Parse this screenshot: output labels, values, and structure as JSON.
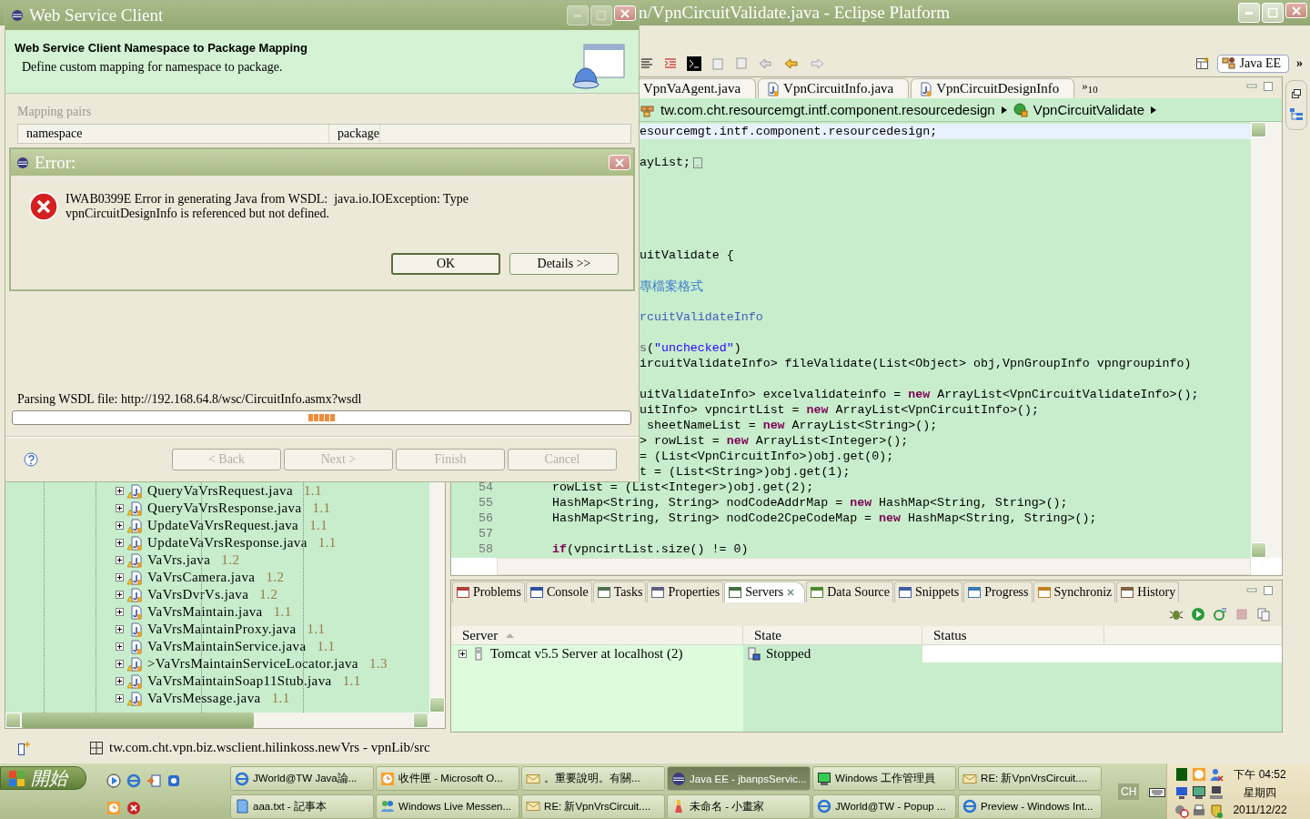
{
  "eclipse": {
    "title": "n/VpnCircuitValidate.java - Eclipse Platform",
    "perspective": "Java EE",
    "toolbar_overflow": "»",
    "editor": {
      "tabs": [
        {
          "label": "VpnVaAgent.java",
          "selected": false
        },
        {
          "label": "VpnCircuitInfo.java",
          "selected": false
        },
        {
          "label": "VpnCircuitDesignInfo",
          "selected": false
        }
      ],
      "more_tabs": "»$_{10}$",
      "breadcrumb": [
        {
          "kind": "package",
          "label": "tw.com.cht.resourcemgt.intf.component.resourcedesign"
        },
        {
          "kind": "class",
          "label": "VpnCircuitValidate"
        }
      ],
      "code_lines": [
        {
          "kind": "code",
          "clipped": true,
          "current": true,
          "parts": [
            {
              "kind": "plain",
              "text": "esourcemgt.intf.component.resourcedesign;"
            }
          ]
        },
        {
          "kind": "blank"
        },
        {
          "kind": "code",
          "clipped": true,
          "folded": true,
          "parts": [
            {
              "kind": "plain",
              "text": "ayList;"
            }
          ]
        },
        {
          "kind": "blank"
        },
        {
          "kind": "blank"
        },
        {
          "kind": "blank"
        },
        {
          "kind": "blank"
        },
        {
          "kind": "blank"
        },
        {
          "kind": "code",
          "clipped": true,
          "parts": [
            {
              "kind": "plain",
              "text": "uitValidate {"
            }
          ]
        },
        {
          "kind": "blank"
        },
        {
          "kind": "code",
          "clipped": true,
          "parts": [
            {
              "kind": "comment",
              "text": "專檔案格式"
            }
          ]
        },
        {
          "kind": "blank"
        },
        {
          "kind": "code",
          "clipped": true,
          "parts": [
            {
              "kind": "javadoc",
              "text": "rcuitValidateInfo"
            }
          ]
        },
        {
          "kind": "blank"
        },
        {
          "kind": "code",
          "clipped": true,
          "parts": [
            {
              "kind": "annotation",
              "text": "s"
            },
            {
              "kind": "plain",
              "text": "("
            },
            {
              "kind": "string",
              "text": "\"unchecked\""
            },
            {
              "kind": "plain",
              "text": ")"
            }
          ]
        },
        {
          "kind": "code",
          "clipped": true,
          "parts": [
            {
              "kind": "plain",
              "text": "ircuitValidateInfo> fileValidate(List<Object> obj,VpnGroupInfo vpngroupinfo)"
            }
          ]
        },
        {
          "kind": "blank"
        },
        {
          "kind": "code",
          "clipped": true,
          "parts": [
            {
              "kind": "plain",
              "text": "uitValidateInfo> excelvalidateinfo = "
            },
            {
              "kind": "keyword",
              "text": "new"
            },
            {
              "kind": "plain",
              "text": " ArrayList<VpnCircuitValidateInfo>();"
            }
          ]
        },
        {
          "kind": "code",
          "clipped": true,
          "parts": [
            {
              "kind": "plain",
              "text": "uitInfo> vpncirtList = "
            },
            {
              "kind": "keyword",
              "text": "new"
            },
            {
              "kind": "plain",
              "text": " ArrayList<VpnCircuitInfo>();"
            }
          ]
        },
        {
          "kind": "code",
          "clipped": true,
          "parts": [
            {
              "kind": "plain",
              "text": " sheetNameList = "
            },
            {
              "kind": "keyword",
              "text": "new"
            },
            {
              "kind": "plain",
              "text": " ArrayList<String>();"
            }
          ]
        },
        {
          "kind": "code",
          "clipped": true,
          "parts": [
            {
              "kind": "plain",
              "text": "> rowList = "
            },
            {
              "kind": "keyword",
              "text": "new"
            },
            {
              "kind": "plain",
              "text": " ArrayList<Integer>();"
            }
          ]
        },
        {
          "kind": "code",
          "clipped": true,
          "parts": [
            {
              "kind": "plain",
              "text": "= (List<VpnCircuitInfo>)obj.get(0);"
            }
          ]
        },
        {
          "kind": "code",
          "clipped": true,
          "parts": [
            {
              "kind": "plain",
              "text": "t = (List<String>)obj.get(1);"
            }
          ]
        },
        {
          "kind": "code",
          "number": "54",
          "clipped": false,
          "parts": [
            {
              "kind": "plain",
              "text": "rowList = (List<Integer>)obj.get(2);"
            }
          ]
        },
        {
          "kind": "code",
          "number": "55",
          "clipped": false,
          "parts": [
            {
              "kind": "plain",
              "text": "HashMap<String, String> nodCodeAddrMap = "
            },
            {
              "kind": "keyword",
              "text": "new"
            },
            {
              "kind": "plain",
              "text": " HashMap<String, String>();"
            }
          ]
        },
        {
          "kind": "code",
          "number": "56",
          "clipped": false,
          "parts": [
            {
              "kind": "plain",
              "text": "HashMap<String, String> nodCode2CpeCodeMap = "
            },
            {
              "kind": "keyword",
              "text": "new"
            },
            {
              "kind": "plain",
              "text": " HashMap<String, String>();"
            }
          ]
        },
        {
          "kind": "blank",
          "number": "57"
        },
        {
          "kind": "code",
          "number": "58",
          "clipped": false,
          "parts": [
            {
              "kind": "keyword",
              "text": "if"
            },
            {
              "kind": "plain",
              "text": "(vpncirtList.size() != 0)"
            }
          ]
        }
      ]
    },
    "explorer": {
      "items": [
        {
          "name": "QueryVaVrsRequest.java",
          "version": "1.1",
          "warning": true,
          "expanded": false
        },
        {
          "name": "QueryVaVrsResponse.java",
          "version": "1.1",
          "warning": true,
          "expanded": false
        },
        {
          "name": "UpdateVaVrsRequest.java",
          "version": "1.1",
          "warning": true,
          "expanded": false
        },
        {
          "name": "UpdateVaVrsResponse.java",
          "version": "1.1",
          "warning": true,
          "expanded": false
        },
        {
          "name": "VaVrs.java",
          "version": "1.2",
          "warning": true,
          "expanded": false
        },
        {
          "name": "VaVrsCamera.java",
          "version": "1.2",
          "warning": true,
          "expanded": false
        },
        {
          "name": "VaVrsDvrVs.java",
          "version": "1.2",
          "warning": true,
          "expanded": false
        },
        {
          "name": "VaVrsMaintain.java",
          "version": "1.1",
          "warning": false,
          "expanded": false
        },
        {
          "name": "VaVrsMaintainProxy.java",
          "version": "1.1",
          "warning": false,
          "expanded": false
        },
        {
          "name": "VaVrsMaintainService.java",
          "version": "1.1",
          "warning": false,
          "expanded": false
        },
        {
          "name": ">VaVrsMaintainServiceLocator.java",
          "version": "1.3",
          "warning": true,
          "expanded": false
        },
        {
          "name": "VaVrsMaintainSoap11Stub.java",
          "version": "1.1",
          "warning": true,
          "expanded": false
        },
        {
          "name": "VaVrsMessage.java",
          "version": "1.1",
          "warning": true,
          "expanded": false
        }
      ]
    },
    "bottom_panel": {
      "tabs": [
        {
          "label": "Problems",
          "selected": false
        },
        {
          "label": "Console",
          "selected": false
        },
        {
          "label": "Tasks",
          "selected": false
        },
        {
          "label": "Properties",
          "selected": false
        },
        {
          "label": "Servers",
          "selected": true
        },
        {
          "label": "Data Source",
          "selected": false
        },
        {
          "label": "Snippets",
          "selected": false
        },
        {
          "label": "Progress",
          "selected": false
        },
        {
          "label": "Synchroniz",
          "selected": false
        },
        {
          "label": "History",
          "selected": false
        }
      ],
      "columns": [
        {
          "label": "Server",
          "sorted": true
        },
        {
          "label": "State",
          "sorted": false
        },
        {
          "label": "Status",
          "sorted": false
        }
      ],
      "rows": [
        {
          "server": "Tomcat v5.5 Server at localhost (2)",
          "state": "Stopped",
          "expanded": false
        }
      ]
    },
    "status_bar": {
      "text": "tw.com.cht.vpn.biz.wsclient.hilinkoss.newVrs - vpnLib/src"
    }
  },
  "wizard": {
    "title": "Web Service Client",
    "heading": "Web Service Client Namespace to Package Mapping",
    "description": "Define custom mapping for namespace to package.",
    "group_label": "Mapping pairs",
    "columns": [
      "namespace",
      "package"
    ],
    "status": "Parsing WSDL file: http://192.168.64.8/wsc/CircuitInfo.asmx?wsdl",
    "buttons": [
      {
        "label": "< Back",
        "disabled": true
      },
      {
        "label": "Next >",
        "disabled": true
      },
      {
        "label": "Finish",
        "disabled": true
      },
      {
        "label": "Cancel",
        "disabled": true
      }
    ]
  },
  "error": {
    "title": "Error:",
    "message": "IWAB0399E Error in generating Java from WSDL:  java.io.IOException: Type vpnCircuitDesignInfo is referenced but not defined.",
    "buttons": [
      {
        "label": "OK",
        "default": true
      },
      {
        "label": "Details >>",
        "default": false
      }
    ]
  },
  "taskbar": {
    "start": "開始",
    "tasks": [
      {
        "kind": "browser",
        "label": "JWorld@TW Java論...",
        "selected": false
      },
      {
        "kind": "outlook",
        "label": "收件匣 - Microsoft O...",
        "selected": false
      },
      {
        "kind": "mail",
        "label": "。重要說明。有關...",
        "selected": false
      },
      {
        "kind": "eclipse",
        "label": "Java EE - jbanpsServic...",
        "selected": true
      },
      {
        "kind": "monitor",
        "label": "Windows 工作管理員",
        "selected": false
      },
      {
        "kind": "mail",
        "label": "RE: 新VpnVrsCircuit....",
        "selected": false
      },
      {
        "kind": "notepad",
        "label": "aaa.txt - 記事本",
        "selected": false
      },
      {
        "kind": "messenger",
        "label": "Windows Live Messen...",
        "selected": false
      },
      {
        "kind": "mail",
        "label": "RE: 新VpnVrsCircuit....",
        "selected": false
      },
      {
        "kind": "paint",
        "label": "未命名 - 小畫家",
        "selected": false
      },
      {
        "kind": "browser",
        "label": "JWorld@TW - Popup ...",
        "selected": false
      },
      {
        "kind": "browser",
        "label": "Preview - Windows Int...",
        "selected": false
      }
    ],
    "language": "CH",
    "clock": {
      "time": "下午 04:52",
      "weekday": "星期四",
      "date": "2011/12/22"
    }
  }
}
